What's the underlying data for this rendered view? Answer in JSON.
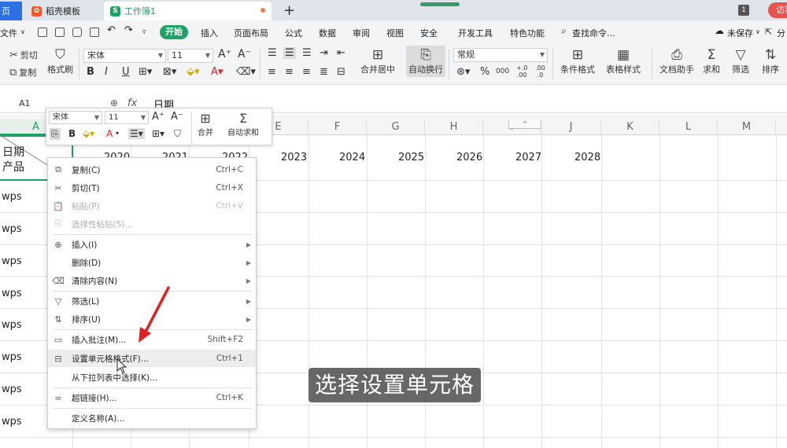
{
  "tabs": {
    "home_label": "页",
    "template_label": "稻壳模板",
    "workbook_label": "工作簿1",
    "workbook_icon": "S",
    "new_tab": "+",
    "page_count": "1",
    "visitor_label": "访客"
  },
  "menu": {
    "file": "文件",
    "start": "开始",
    "insert": "插入",
    "page_layout": "页面布局",
    "formula": "公式",
    "data": "数据",
    "review": "审阅",
    "view": "视图",
    "security": "安全",
    "dev_tools": "开发工具",
    "special": "特色功能",
    "search": "查找命令...",
    "unsaved": "未保存",
    "share": "分"
  },
  "ribbon": {
    "cut": "剪切",
    "copy": "复制",
    "format_painter": "格式刷",
    "font_name": "宋体",
    "font_size": "11",
    "merge_center": "合并居中",
    "wrap_text": "自动换行",
    "number_format": "常规",
    "conditional_format": "条件格式",
    "table_style": "表格样式",
    "doc_assistant": "文档助手",
    "sum": "求和",
    "filter": "筛选",
    "sort": "排序",
    "inc_dec_1": ".00",
    "inc_dec_2": "+.0",
    "inc_dec_3": ".0",
    "inc_dec_4": ".00",
    "percent": "%",
    "thousands": "000"
  },
  "formula_bar": {
    "name_box": "A1",
    "fx": "fx",
    "value": "日期"
  },
  "columns": [
    "A",
    "E",
    "F",
    "G",
    "H",
    "I",
    "J",
    "K",
    "L",
    "M"
  ],
  "header_row": {
    "a1_line1": "日期",
    "a1_line2": "产品",
    "years": [
      "2020",
      "2021",
      "2022",
      "2023",
      "2024",
      "2025",
      "2026",
      "2027",
      "2028"
    ]
  },
  "row_values": [
    "wps",
    "wps",
    "wps",
    "wps",
    "wps",
    "wps",
    "wps",
    "wps"
  ],
  "mini_toolbar": {
    "font_name": "宋体",
    "font_size": "11",
    "merge": "合并",
    "auto_sum": "自动求和",
    "bold": "B",
    "font_color": "A"
  },
  "context_menu": [
    {
      "label": "复制(C)",
      "shortcut": "Ctrl+C",
      "icon": "copy-icon",
      "disabled": false
    },
    {
      "label": "剪切(T)",
      "shortcut": "Ctrl+X",
      "icon": "cut-icon",
      "disabled": false
    },
    {
      "label": "粘贴(P)",
      "shortcut": "Ctrl+V",
      "icon": "paste-icon",
      "disabled": true
    },
    {
      "label": "选择性粘贴(S)...",
      "shortcut": "",
      "icon": "paste-special-icon",
      "disabled": true
    },
    {
      "label": "插入(I)",
      "shortcut": "",
      "icon": "insert-icon",
      "disabled": false,
      "submenu": true
    },
    {
      "label": "删除(D)",
      "shortcut": "",
      "icon": "",
      "disabled": false,
      "submenu": true
    },
    {
      "label": "清除内容(N)",
      "shortcut": "",
      "icon": "eraser-icon",
      "disabled": false,
      "submenu": true
    },
    {
      "label": "筛选(L)",
      "shortcut": "",
      "icon": "filter-icon",
      "disabled": false,
      "submenu": true
    },
    {
      "label": "排序(U)",
      "shortcut": "",
      "icon": "sort-icon",
      "disabled": false,
      "submenu": true
    },
    {
      "label": "插入批注(M)...",
      "shortcut": "Shift+F2",
      "icon": "comment-icon",
      "disabled": false
    },
    {
      "label": "设置单元格格式(F)...",
      "shortcut": "Ctrl+1",
      "icon": "format-cells-icon",
      "disabled": false,
      "highlighted": true
    },
    {
      "label": "从下拉列表中选择(K)...",
      "shortcut": "",
      "icon": "",
      "disabled": false
    },
    {
      "label": "超链接(H)...",
      "shortcut": "Ctrl+K",
      "icon": "link-icon",
      "disabled": false
    },
    {
      "label": "定义名称(A)...",
      "shortcut": "",
      "icon": "",
      "disabled": false
    }
  ],
  "subtitle": "选择设置单元格",
  "colors": {
    "accent_green": "#1fa065",
    "tab_blue": "#2f6fe4",
    "visitor_red": "#e9534b",
    "arrow_red": "#e02020"
  }
}
